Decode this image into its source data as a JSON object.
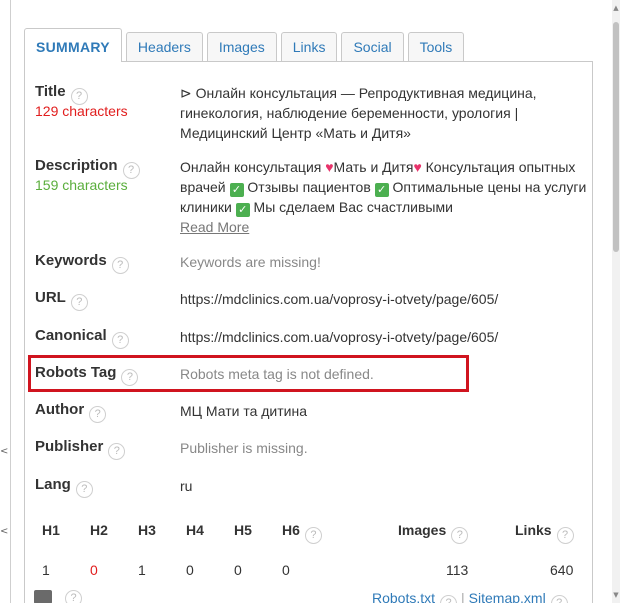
{
  "tabs": [
    {
      "label": "SUMMARY",
      "active": true
    },
    {
      "label": "Headers"
    },
    {
      "label": "Images"
    },
    {
      "label": "Links"
    },
    {
      "label": "Social"
    },
    {
      "label": "Tools"
    }
  ],
  "help_glyph": "?",
  "summary": {
    "title": {
      "label": "Title",
      "count": "129 characters",
      "value": "⊳ Онлайн консультация — Репродуктивная медицина, гинекология, наблюдение беременности, урология | Медицинский Центр «Мать и Дитя»"
    },
    "description": {
      "label": "Description",
      "count": "159 characters",
      "segments": [
        "Онлайн консультация ",
        "Мать и Дитя",
        " Консультация опытных врачей ",
        " Отзывы пациентов ",
        " Оптимальные цены на услуги клиники ",
        " Мы сделаем Вас счастливыми"
      ],
      "read_more": "Read More"
    },
    "keywords": {
      "label": "Keywords",
      "value": "Keywords are missing!"
    },
    "url": {
      "label": "URL",
      "value": "https://mdclinics.com.ua/voprosy-i-otvety/page/605/"
    },
    "canonical": {
      "label": "Canonical",
      "value": "https://mdclinics.com.ua/voprosy-i-otvety/page/605/"
    },
    "robots": {
      "label": "Robots Tag",
      "value": "Robots meta tag is not defined."
    },
    "author": {
      "label": "Author",
      "value": "МЦ Мати та дитина"
    },
    "publisher": {
      "label": "Publisher",
      "value": "Publisher is missing."
    },
    "lang": {
      "label": "Lang",
      "value": "ru"
    }
  },
  "stats": {
    "headers": [
      "H1",
      "H2",
      "H3",
      "H4",
      "H5",
      "H6",
      "Images",
      "Links"
    ],
    "values": [
      "1",
      "0",
      "1",
      "0",
      "0",
      "0",
      "113",
      "640"
    ]
  },
  "bottom_links": {
    "robots": "Robots.txt",
    "sitemap": "Sitemap.xml"
  },
  "colors": {
    "accent": "#2f7ab8",
    "warning": "#e11d1d",
    "ok": "#5aae3c",
    "highlight": "#d0141f"
  }
}
